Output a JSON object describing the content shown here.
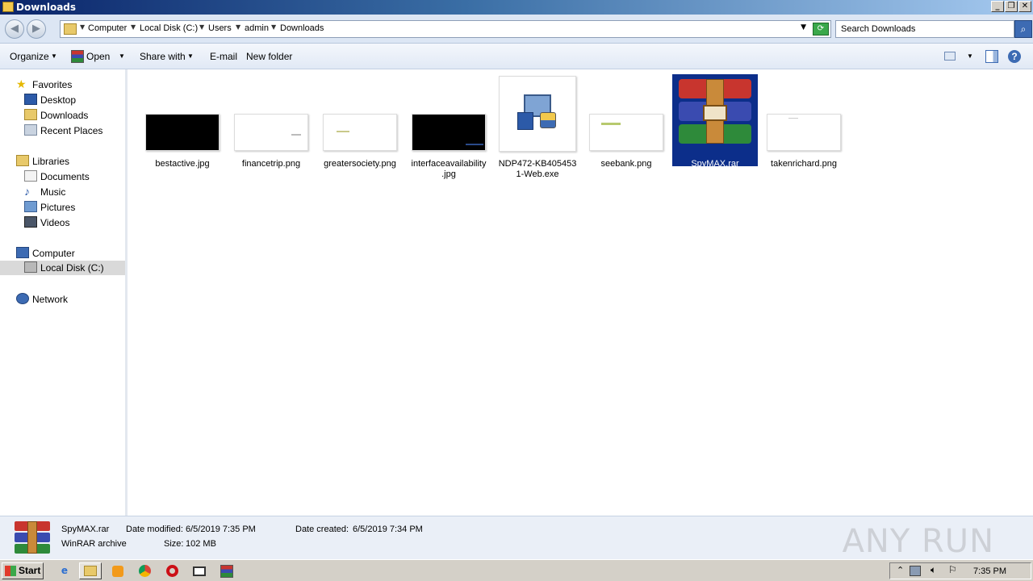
{
  "window": {
    "title": "Downloads"
  },
  "address": {
    "crumbs": [
      "Computer",
      "Local Disk (C:)",
      "Users",
      "admin",
      "Downloads"
    ]
  },
  "search": {
    "placeholder": "Search Downloads"
  },
  "toolbar": {
    "organize": "Organize",
    "open": "Open",
    "share_with": "Share with",
    "email": "E-mail",
    "new_folder": "New folder"
  },
  "nav": {
    "favorites": "Favorites",
    "desktop": "Desktop",
    "downloads": "Downloads",
    "recent_places": "Recent Places",
    "libraries": "Libraries",
    "documents": "Documents",
    "music": "Music",
    "pictures": "Pictures",
    "videos": "Videos",
    "computer": "Computer",
    "local_disk": "Local Disk (C:)",
    "network": "Network"
  },
  "files": [
    {
      "name": "bestactive.jpg",
      "thumb": "#000000"
    },
    {
      "name": "financetrip.png",
      "thumb": "#ffffff"
    },
    {
      "name": "greatersociety.png",
      "thumb": "#ffffff"
    },
    {
      "name": "interfaceavailability.jpg",
      "line1": "interfaceavailability",
      "line2": ".jpg",
      "thumb": "#000000"
    },
    {
      "name": "NDP472-KB4054531-Web.exe",
      "line1": "NDP472-KB405453",
      "line2": "1-Web.exe"
    },
    {
      "name": "seebank.png",
      "thumb": "#ffffff"
    },
    {
      "name": "SpyMAX.rar"
    },
    {
      "name": "takenrichard.png",
      "thumb": "#ffffff"
    }
  ],
  "details": {
    "name": "SpyMAX.rar",
    "type": "WinRAR archive",
    "modified_label": "Date modified:",
    "modified_value": "6/5/2019 7:35 PM",
    "created_label": "Date created:",
    "created_value": "6/5/2019 7:34 PM",
    "size_label": "Size:",
    "size_value": "102 MB"
  },
  "watermark": "ANY RUN",
  "taskbar": {
    "start": "Start",
    "clock": "7:35 PM"
  },
  "colors": {
    "selection": "#0c2e8a",
    "title_gradient_start": "#0a246a",
    "title_gradient_end": "#a6caf0"
  }
}
